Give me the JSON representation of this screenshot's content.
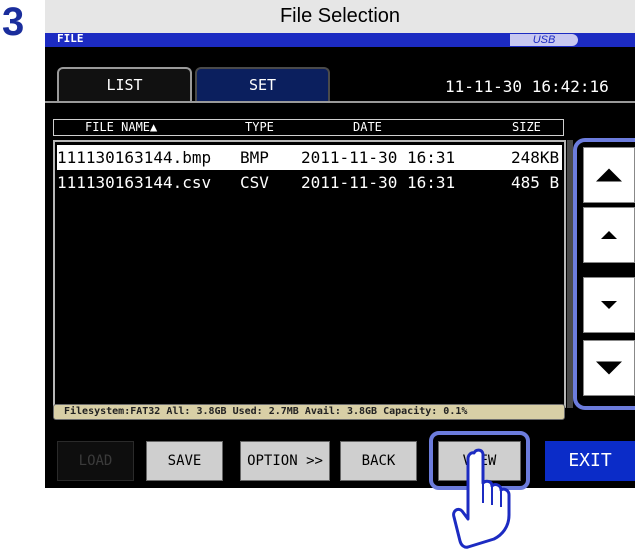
{
  "step": {
    "number": "3"
  },
  "title_bar": {
    "title": "File Selection"
  },
  "screen": {
    "header_label": "FILE",
    "media": "USB",
    "clock": "11-11-30 16:42:16"
  },
  "tabs": [
    {
      "label": "LIST",
      "active": true
    },
    {
      "label": "SET",
      "active": false
    }
  ],
  "file_list": {
    "columns": [
      "FILE NAME▲",
      "TYPE",
      "DATE",
      "SIZE"
    ],
    "rows": [
      {
        "name": "111130163144.bmp",
        "type": "BMP",
        "date": "2011-11-30 16:31",
        "size": "248KB",
        "selected": true
      },
      {
        "name": "111130163144.csv",
        "type": "CSV",
        "date": "2011-11-30 16:31",
        "size": "485 B",
        "selected": false
      }
    ]
  },
  "scroll_buttons": [
    {
      "icon": "double-up-arrow-icon"
    },
    {
      "icon": "up-arrow-icon"
    },
    {
      "icon": "down-arrow-icon"
    },
    {
      "icon": "double-down-arrow-icon"
    }
  ],
  "status_bar": {
    "text": "Filesystem:FAT32 All: 3.8GB Used: 2.7MB Avail: 3.8GB Capacity: 0.1%"
  },
  "buttons": {
    "load": "LOAD",
    "save": "SAVE",
    "option": "OPTION >>",
    "back": "BACK",
    "view": "VIEW",
    "exit": "EXIT"
  },
  "colors": {
    "accent_blue": "#1c2bc2",
    "highlight": "#6c7cdc",
    "exit_button": "#0b2cc8",
    "status_bar": "#d8cfa6"
  }
}
